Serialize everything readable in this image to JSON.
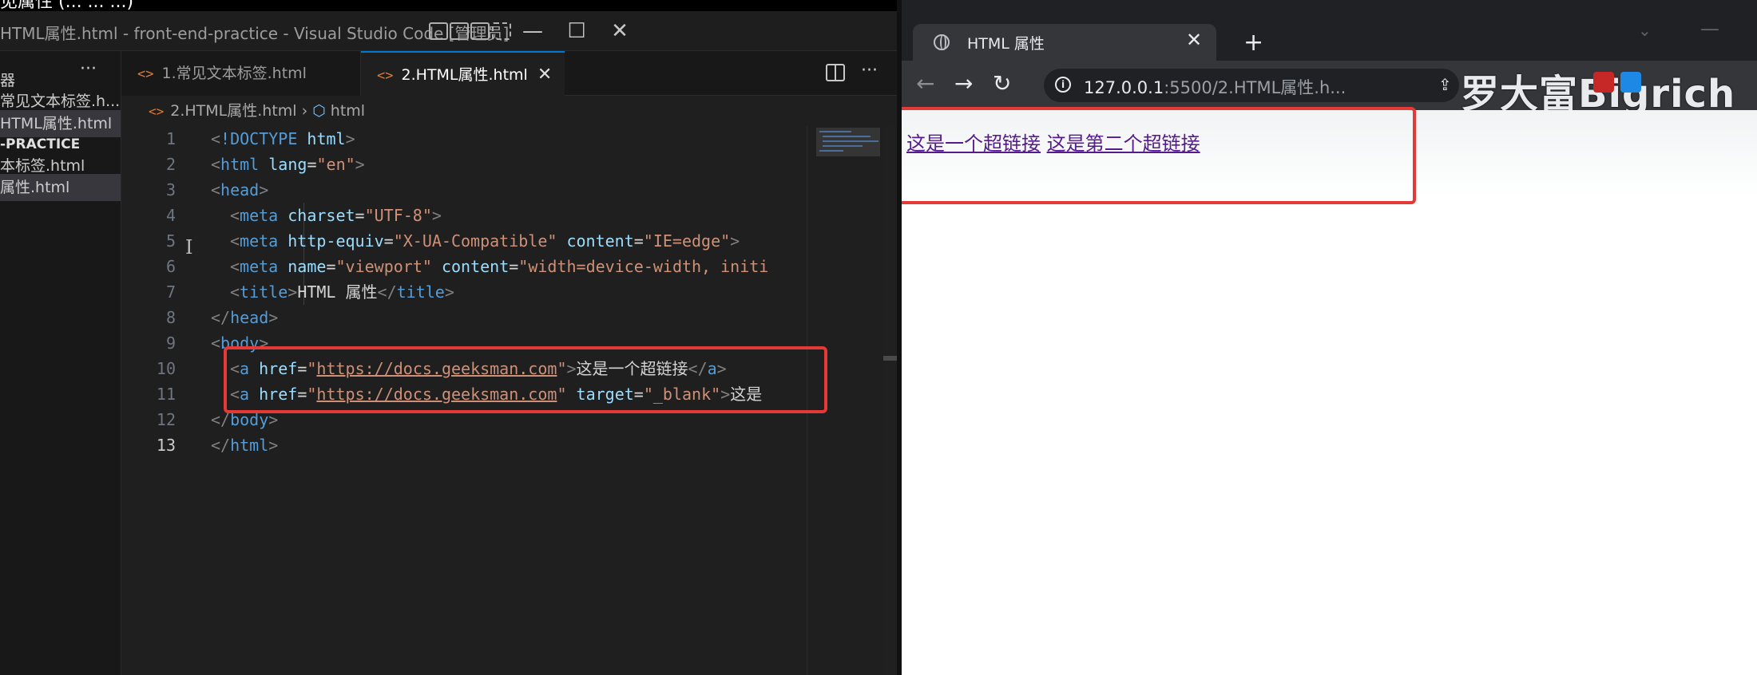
{
  "overlay": {
    "top_text": "见属性 (... ... ...)"
  },
  "vscode": {
    "window_title": "HTML属性.html - front-end-practice - Visual Studio Code [管理员]",
    "controls": {
      "minimize": "—",
      "maximize": "☐",
      "close": "✕"
    },
    "sidebar": {
      "more": "···",
      "items": [
        {
          "label": "器",
          "active": false,
          "folder": false
        },
        {
          "label": "常见文本标签.h...",
          "active": false,
          "folder": false
        },
        {
          "label": "HTML属性.html",
          "active": true,
          "folder": false
        },
        {
          "label": "-PRACTICE",
          "active": false,
          "folder": true
        },
        {
          "label": "本标签.html",
          "active": false,
          "folder": false
        },
        {
          "label": "属性.html",
          "active": true,
          "folder": false
        }
      ]
    },
    "tabs": [
      {
        "icon": "<>",
        "label": "1.常见文本标签.html"
      },
      {
        "icon": "<>",
        "label": "2.HTML属性.html",
        "close": "✕"
      }
    ],
    "tabbar_more": "···",
    "breadcrumb": {
      "file": "2.HTML属性.html",
      "sep": "›",
      "symbol": "html"
    },
    "current_line": 13,
    "lines": [
      {
        "n": "1"
      },
      {
        "n": "2"
      },
      {
        "n": "3"
      },
      {
        "n": "4"
      },
      {
        "n": "5"
      },
      {
        "n": "6"
      },
      {
        "n": "7"
      },
      {
        "n": "8"
      },
      {
        "n": "9"
      },
      {
        "n": "10"
      },
      {
        "n": "11"
      },
      {
        "n": "12"
      },
      {
        "n": "13"
      }
    ],
    "code": {
      "l1_doctype": "!DOCTYPE",
      "l1_html": " html",
      "html": "html",
      "lang_attr": " lang",
      "lang_val": "\"en\"",
      "head": "head",
      "meta": "meta",
      "charset_attr": " charset",
      "charset_val": "\"UTF-8\"",
      "httpequiv_attr": " http-equiv",
      "httpequiv_val": "\"X-UA-Compatible\"",
      "content_attr": " content",
      "content_val1": "\"IE=edge\"",
      "name_attr": " name",
      "name_val": "\"viewport\"",
      "content_val2": "\"width=device-width, initi",
      "title": "title",
      "title_text": "HTML 属性",
      "body": "body",
      "a": "a",
      "href_attr": " href",
      "href_val_q": "\"",
      "href_url": "https://docs.geeksman.com",
      "link1_text": "这是一个超链接",
      "target_attr": " target",
      "target_val": "\"_blank\"",
      "link2_text": "这是",
      "eq": "=",
      "lt": "<",
      "gt": ">",
      "lt_slash": "</"
    }
  },
  "browser": {
    "tab_title": "HTML 属性",
    "tab_close": "✕",
    "new_tab": "+",
    "url_host": "127.0.0.1",
    "url_rest": ":5500/2.HTML属性.h...",
    "watermark": "罗大富Bigrich",
    "nav": {
      "back": "←",
      "forward": "→",
      "reload": "↻"
    },
    "page_links": [
      "这是一个超链接",
      "这是第二个超链接"
    ]
  },
  "colors": {
    "highlight_box": "#e53935",
    "visited_link": "#551a8b",
    "accent": "#0078d4"
  }
}
